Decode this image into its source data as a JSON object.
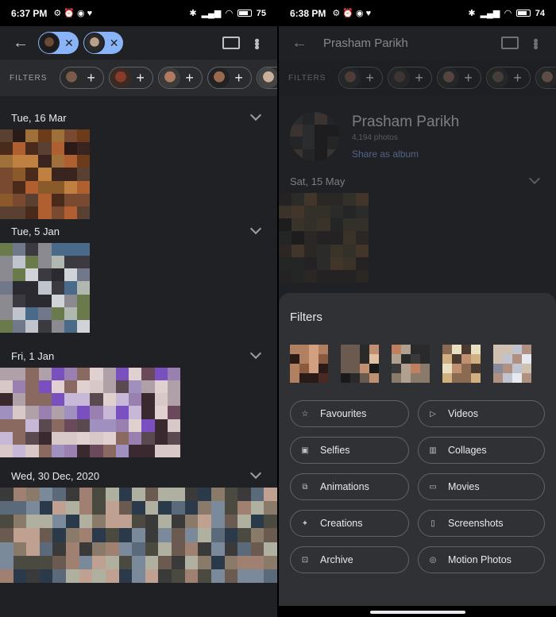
{
  "left": {
    "status": {
      "time": "6:37 PM",
      "battery": "75"
    },
    "filters_label": "FILTERS",
    "sections": [
      {
        "date": "Tue, 16 Mar"
      },
      {
        "date": "Tue, 5 Jan"
      },
      {
        "date": "Fri, 1 Jan"
      },
      {
        "date": "Wed, 30 Dec, 2020"
      }
    ]
  },
  "right": {
    "status": {
      "time": "6:38 PM",
      "battery": "74"
    },
    "title": "Prasham Parikh",
    "filters_label": "FILTERS",
    "person": {
      "name": "Prasham Parikh",
      "count": "4,194 photos",
      "share": "Share as album"
    },
    "date": "Sat, 15 May",
    "sheet": {
      "title": "Filters",
      "buttons": [
        {
          "label": "Favourites",
          "icon": "star-icon"
        },
        {
          "label": "Videos",
          "icon": "play-circle-icon"
        },
        {
          "label": "Selfies",
          "icon": "portrait-icon"
        },
        {
          "label": "Collages",
          "icon": "collage-icon"
        },
        {
          "label": "Animations",
          "icon": "animation-icon"
        },
        {
          "label": "Movies",
          "icon": "film-icon"
        },
        {
          "label": "Creations",
          "icon": "sparkle-icon"
        },
        {
          "label": "Screenshots",
          "icon": "phone-icon"
        },
        {
          "label": "Archive",
          "icon": "archive-icon"
        },
        {
          "label": "Motion Photos",
          "icon": "motion-photo-icon"
        }
      ]
    }
  }
}
